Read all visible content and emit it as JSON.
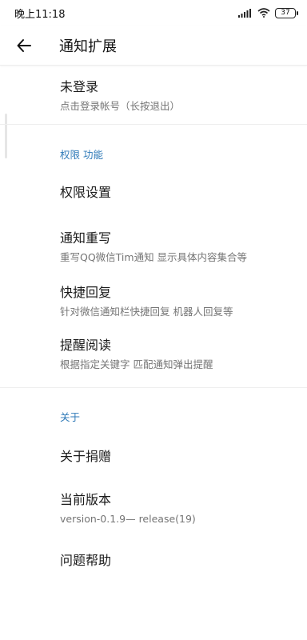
{
  "status_bar": {
    "time": "晚上11:18",
    "battery": "37"
  },
  "app_bar": {
    "title": "通知扩展"
  },
  "account": {
    "title": "未登录",
    "subtitle": "点击登录帐号（长按退出）"
  },
  "sections": {
    "features": {
      "header": "权限 功能",
      "items": [
        {
          "title": "权限设置",
          "subtitle": ""
        },
        {
          "title": "通知重写",
          "subtitle": "重写QQ微信Tim通知 显示具体内容集合等"
        },
        {
          "title": "快捷回复",
          "subtitle": "针对微信通知栏快捷回复 机器人回复等"
        },
        {
          "title": "提醒阅读",
          "subtitle": "根据指定关键字 匹配通知弹出提醒"
        }
      ]
    },
    "about": {
      "header": "关于",
      "items": [
        {
          "title": "关于捐赠",
          "subtitle": ""
        },
        {
          "title": "当前版本",
          "subtitle": "version-0.1.9— release(19)"
        },
        {
          "title": "问题帮助",
          "subtitle": ""
        }
      ]
    }
  },
  "colors": {
    "accent": "#2f7ab8",
    "divider": "#eeeeee",
    "secondary_text": "#757575"
  }
}
